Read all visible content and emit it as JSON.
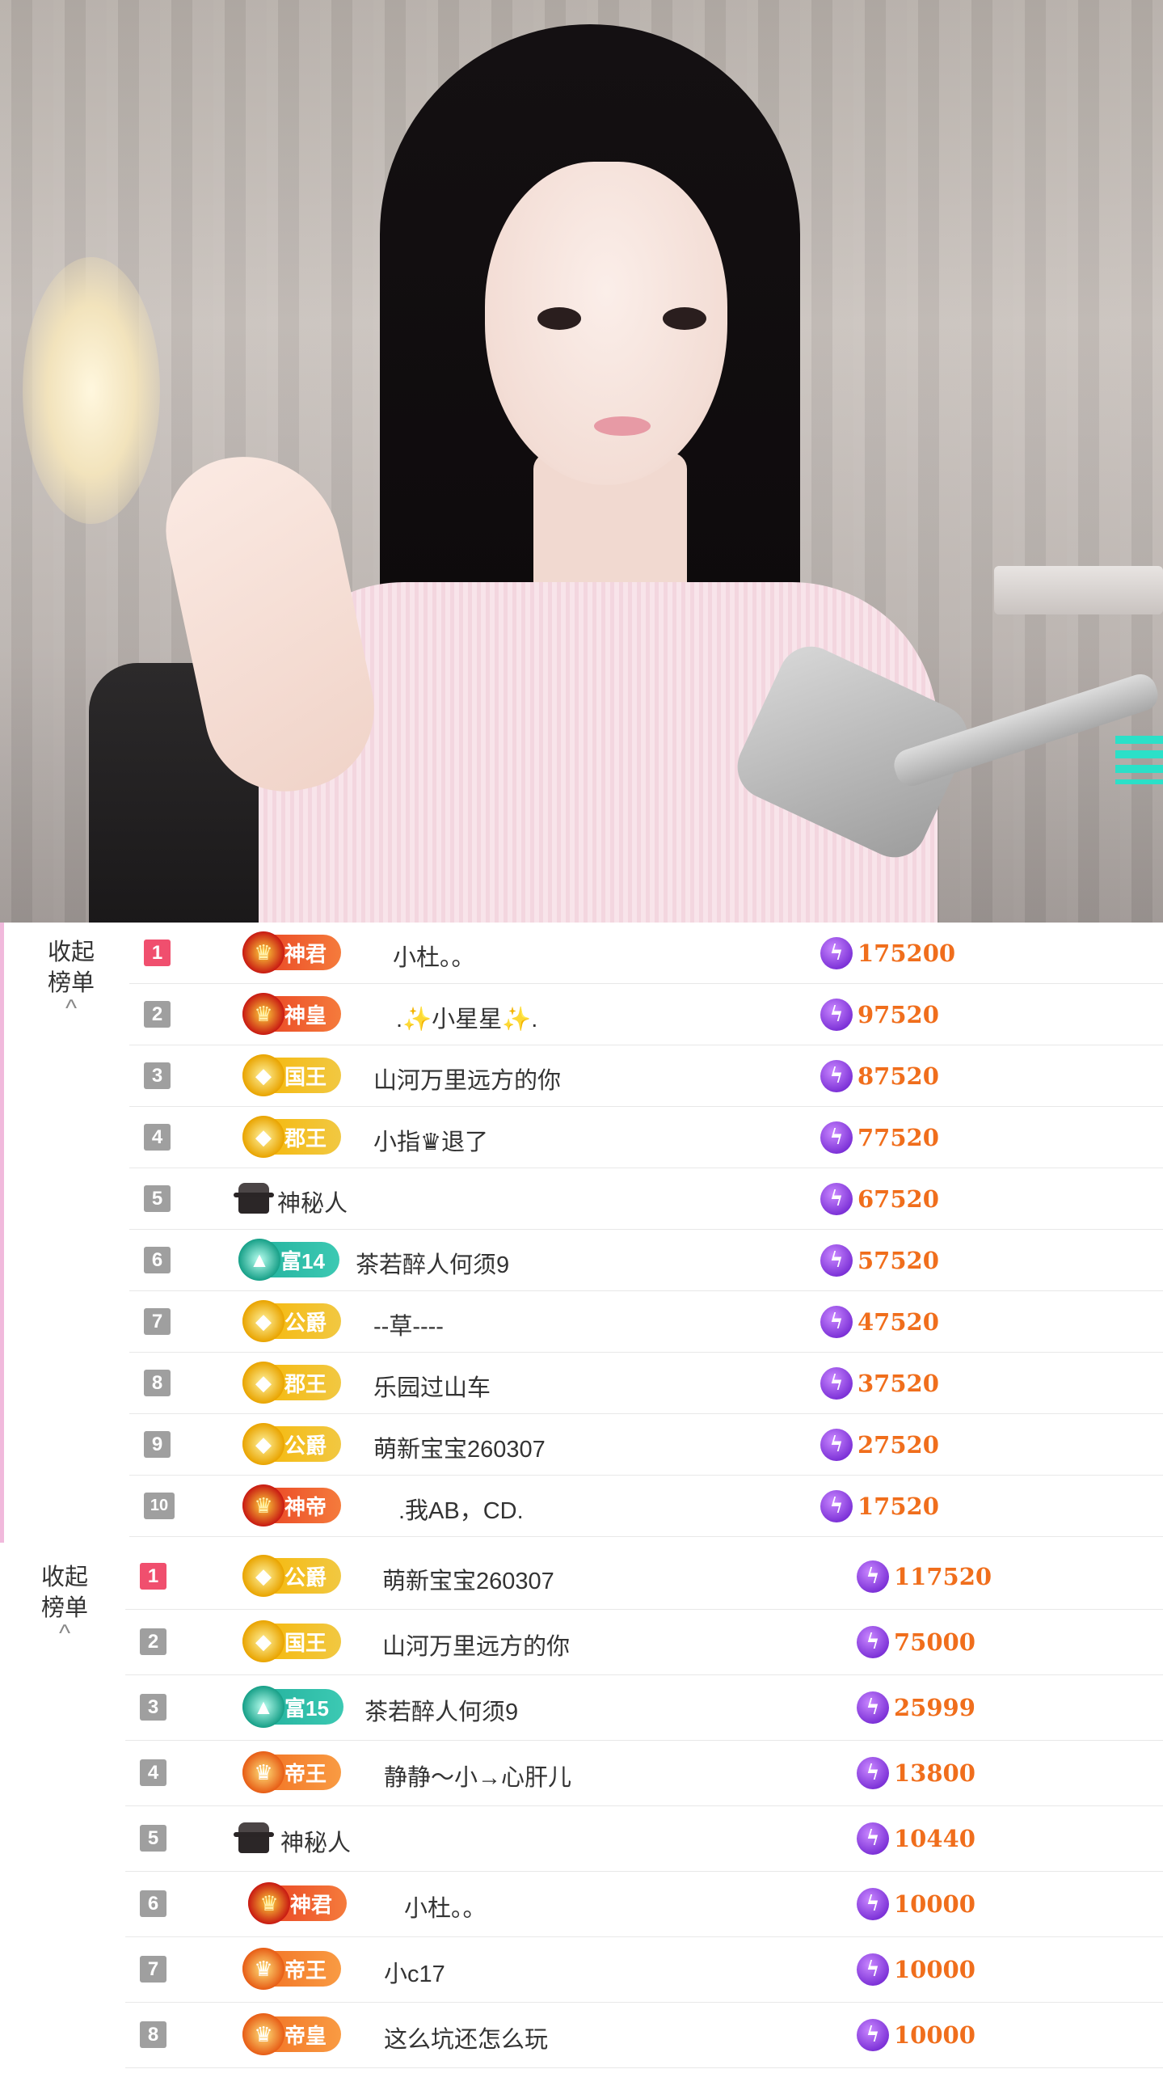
{
  "panel1": {
    "toggle_line1": "收起",
    "toggle_line2": "榜单",
    "chevron": "^",
    "rows": [
      {
        "rank": "1",
        "badge": "神君",
        "name": "小杜。。",
        "score": "175200"
      },
      {
        "rank": "2",
        "badge": "神皇",
        "name": ".✨小星星✨.",
        "score": "97520"
      },
      {
        "rank": "3",
        "badge": "国王",
        "name": "山河万里远方的你",
        "score": "87520"
      },
      {
        "rank": "4",
        "badge": "郡王",
        "name": "小指♛退了",
        "score": "77520"
      },
      {
        "rank": "5",
        "badge": "",
        "name": "神秘人",
        "score": "67520"
      },
      {
        "rank": "6",
        "badge": "富14",
        "name": "茶若醉人何须9",
        "score": "57520"
      },
      {
        "rank": "7",
        "badge": "公爵",
        "name": "--草----",
        "score": "47520"
      },
      {
        "rank": "8",
        "badge": "郡王",
        "name": "乐园过山车",
        "score": "37520"
      },
      {
        "rank": "9",
        "badge": "公爵",
        "name": "萌新宝宝260307",
        "score": "27520"
      },
      {
        "rank": "10",
        "badge": "神帝",
        "name": ".我AB，CD.",
        "score": "17520"
      }
    ]
  },
  "panel2": {
    "toggle_line1": "收起",
    "toggle_line2": "榜单",
    "chevron": "^",
    "rows": [
      {
        "rank": "1",
        "badge": "公爵",
        "name": "萌新宝宝260307",
        "score": "117520"
      },
      {
        "rank": "2",
        "badge": "国王",
        "name": "山河万里远方的你",
        "score": "75000"
      },
      {
        "rank": "3",
        "badge": "富15",
        "name": "茶若醉人何须9",
        "score": "25999"
      },
      {
        "rank": "4",
        "badge": "帝王",
        "name": "静静～小→心肝儿",
        "score": "13800"
      },
      {
        "rank": "5",
        "badge": "",
        "name": "神秘人",
        "score": "10440"
      },
      {
        "rank": "6",
        "badge": "神君",
        "name": "小杜。。",
        "score": "10000"
      },
      {
        "rank": "7",
        "badge": "帝王",
        "name": "小c17",
        "score": "10000"
      },
      {
        "rank": "8",
        "badge": "帝皇",
        "name": "这么坑还怎么玩",
        "score": "10000"
      }
    ]
  },
  "icons": {
    "score": "bolt-icon",
    "anonymous": "mystery-user-icon"
  },
  "colors": {
    "score_text": "#f06e1c",
    "top_rank": "#f04f6e",
    "rank": "#9f9f9f",
    "panel_accent": "#f1b9dc"
  }
}
